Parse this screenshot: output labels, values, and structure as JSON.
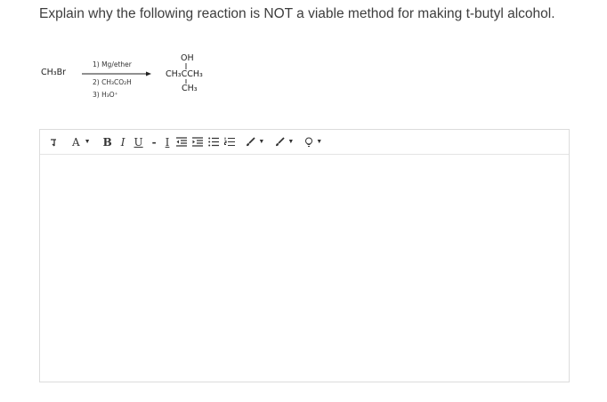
{
  "question": {
    "text": "Explain why the following reaction is NOT a viable method for making t-butyl alcohol."
  },
  "scheme": {
    "reactant": "CH₃Br",
    "steps": [
      "1) Mg/ether",
      "2) CH₃CO₂H",
      "3) H₃O⁺"
    ],
    "product_top": "OH",
    "product_middle": "CH₃CCH₃",
    "product_bottom": "CH₃"
  },
  "toolbar": {
    "font_label": "A",
    "bold_label": "B",
    "italic_label": "I",
    "underline_label": "U",
    "strike_label": "-",
    "clear_format_label": "I"
  },
  "editor": {
    "value": ""
  }
}
